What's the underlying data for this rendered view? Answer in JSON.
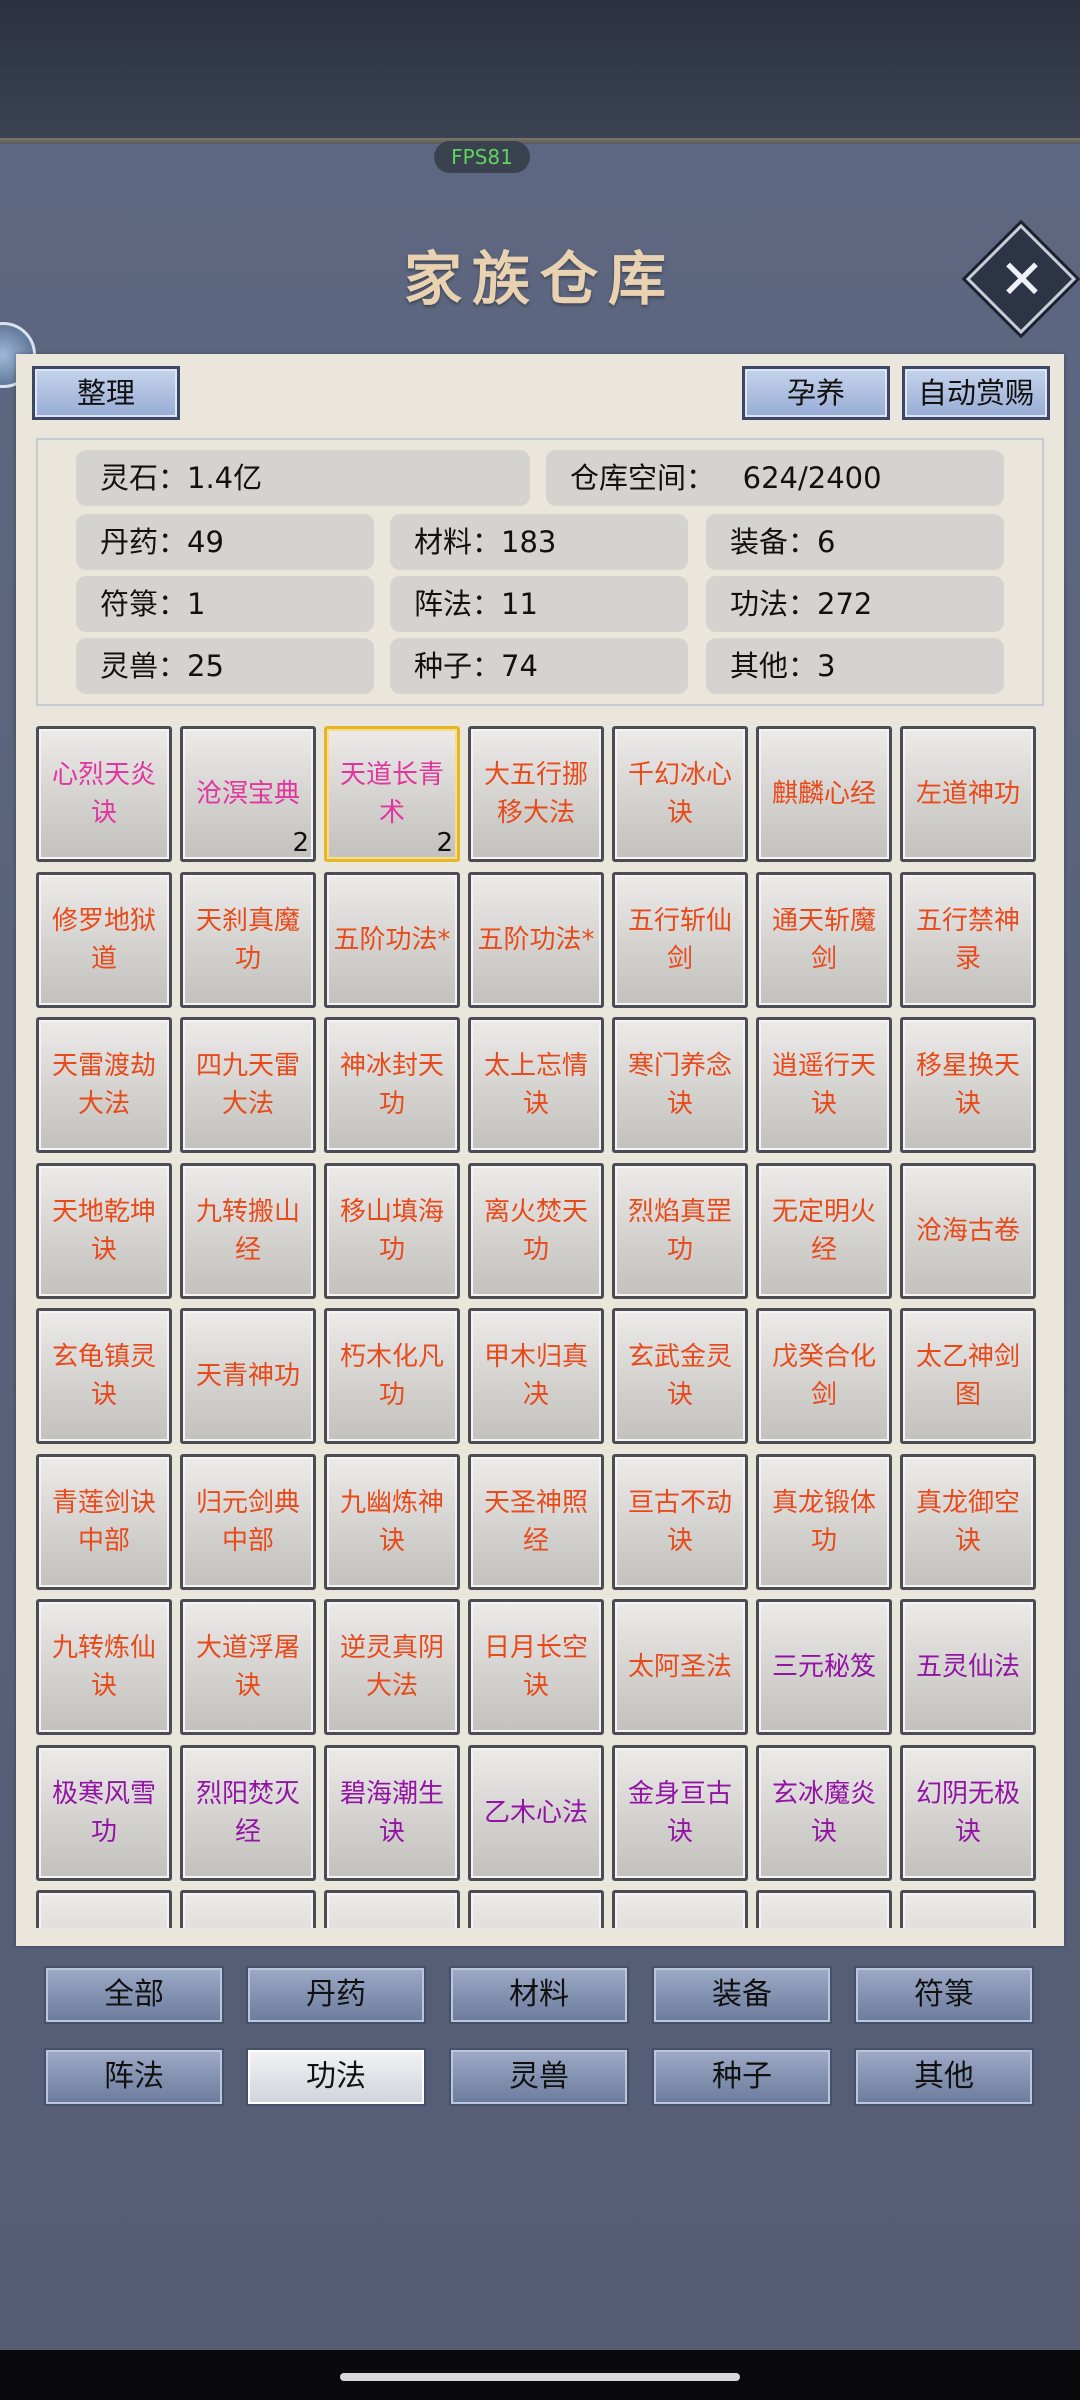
{
  "header": {
    "fps": "FPS81",
    "title": "家族仓库",
    "close_icon": "close-icon"
  },
  "actions": {
    "sort": "整理",
    "nurture": "孕养",
    "auto_reward": "自动赏赐"
  },
  "stats": {
    "spirit_stone": "灵石：1.4亿",
    "storage": "仓库空间：   624/2400",
    "pills": "丹药：49",
    "materials": "材料：183",
    "equipment": "装备：6",
    "talismans": "符箓：1",
    "formations": "阵法：11",
    "techniques": "功法：272",
    "beasts": "灵兽：25",
    "seeds": "种子：74",
    "others": "其他：3"
  },
  "colors": {
    "orange": "#e84a1a",
    "pink": "#e0369e",
    "purple": "#9314a4",
    "selected_border": "#e6b628"
  },
  "grid": {
    "items": [
      {
        "name": "心烈天炎诀",
        "color": "pink"
      },
      {
        "name": "沧溟宝典",
        "color": "pink",
        "count": "2"
      },
      {
        "name": "天道长青术",
        "color": "pink",
        "count": "2",
        "selected": true
      },
      {
        "name": "大五行挪移大法",
        "color": "orange"
      },
      {
        "name": "千幻冰心诀",
        "color": "orange"
      },
      {
        "name": "麒麟心经",
        "color": "orange"
      },
      {
        "name": "左道神功",
        "color": "orange"
      },
      {
        "name": "修罗地狱道",
        "color": "orange"
      },
      {
        "name": "天刹真魔功",
        "color": "orange"
      },
      {
        "name": "五阶功法*",
        "color": "orange"
      },
      {
        "name": "五阶功法*",
        "color": "orange"
      },
      {
        "name": "五行斩仙剑",
        "color": "orange"
      },
      {
        "name": "通天斩魔剑",
        "color": "orange"
      },
      {
        "name": "五行禁神录",
        "color": "orange"
      },
      {
        "name": "天雷渡劫大法",
        "color": "orange"
      },
      {
        "name": "四九天雷大法",
        "color": "orange"
      },
      {
        "name": "神冰封天功",
        "color": "orange"
      },
      {
        "name": "太上忘情诀",
        "color": "orange"
      },
      {
        "name": "寒门养念诀",
        "color": "orange"
      },
      {
        "name": "逍遥行天诀",
        "color": "orange"
      },
      {
        "name": "移星换天诀",
        "color": "orange"
      },
      {
        "name": "天地乾坤诀",
        "color": "orange"
      },
      {
        "name": "九转搬山经",
        "color": "orange"
      },
      {
        "name": "移山填海功",
        "color": "orange"
      },
      {
        "name": "离火焚天功",
        "color": "orange"
      },
      {
        "name": "烈焰真罡功",
        "color": "orange"
      },
      {
        "name": "无定明火经",
        "color": "orange"
      },
      {
        "name": "沧海古卷",
        "color": "orange"
      },
      {
        "name": "玄龟镇灵诀",
        "color": "orange"
      },
      {
        "name": "天青神功",
        "color": "orange"
      },
      {
        "name": "朽木化凡功",
        "color": "orange"
      },
      {
        "name": "甲木归真决",
        "color": "orange"
      },
      {
        "name": "玄武金灵诀",
        "color": "orange"
      },
      {
        "name": "戊癸合化剑",
        "color": "orange"
      },
      {
        "name": "太乙神剑图",
        "color": "orange"
      },
      {
        "name": "青莲剑诀中部",
        "color": "orange"
      },
      {
        "name": "归元剑典中部",
        "color": "orange"
      },
      {
        "name": "九幽炼神诀",
        "color": "orange"
      },
      {
        "name": "天圣神照经",
        "color": "orange"
      },
      {
        "name": "亘古不动诀",
        "color": "orange"
      },
      {
        "name": "真龙锻体功",
        "color": "orange"
      },
      {
        "name": "真龙御空诀",
        "color": "orange"
      },
      {
        "name": "九转炼仙诀",
        "color": "orange"
      },
      {
        "name": "大道浮屠诀",
        "color": "orange"
      },
      {
        "name": "逆灵真阴大法",
        "color": "orange"
      },
      {
        "name": "日月长空诀",
        "color": "orange"
      },
      {
        "name": "太阿圣法",
        "color": "orange"
      },
      {
        "name": "三元秘笈",
        "color": "purple"
      },
      {
        "name": "五灵仙法",
        "color": "purple"
      },
      {
        "name": "极寒风雪功",
        "color": "purple"
      },
      {
        "name": "烈阳焚灭经",
        "color": "purple"
      },
      {
        "name": "碧海潮生诀",
        "color": "purple"
      },
      {
        "name": "乙木心法",
        "color": "purple"
      },
      {
        "name": "金身亘古诀",
        "color": "purple"
      },
      {
        "name": "玄冰魔炎诀",
        "color": "purple"
      },
      {
        "name": "幻阴无极诀",
        "color": "purple"
      },
      {
        "name": "",
        "color": "purple"
      },
      {
        "name": "",
        "color": "purple"
      },
      {
        "name": "",
        "color": "purple"
      },
      {
        "name": "",
        "color": "purple"
      },
      {
        "name": "",
        "color": "purple"
      },
      {
        "name": "",
        "color": "purple"
      },
      {
        "name": "",
        "color": "purple"
      }
    ]
  },
  "tabs": {
    "all": "全部",
    "pills": "丹药",
    "materials": "材料",
    "equipment": "装备",
    "talismans": "符箓",
    "formations": "阵法",
    "techniques": "功法",
    "beasts": "灵兽",
    "seeds": "种子",
    "others": "其他",
    "active": "techniques"
  }
}
